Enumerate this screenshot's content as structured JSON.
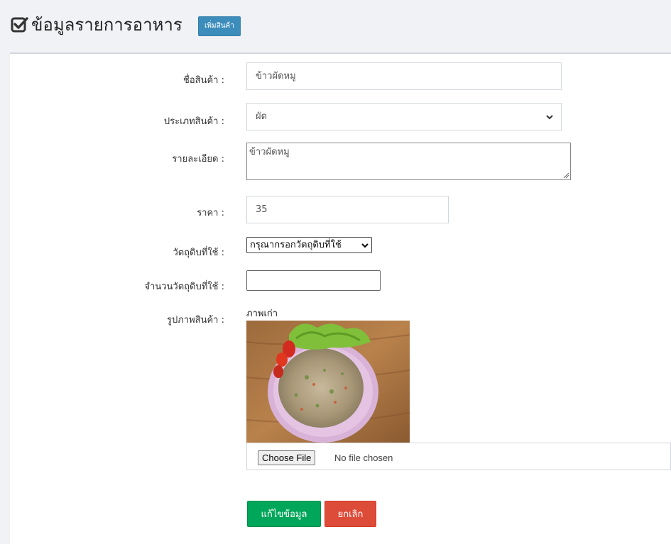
{
  "header": {
    "title": "ข้อมูลรายการอาหาร",
    "add_button": "เพิ่มสินค้า",
    "icon": "check-square-icon"
  },
  "form": {
    "name_label": "ชื่อสินค้า :",
    "name_value": "ข้าวผัดหมู",
    "type_label": "ประเภทสินค้า :",
    "type_value": "ผัด",
    "detail_label": "รายละเอียด :",
    "detail_value": "ข้าวผัดหมู",
    "price_label": "ราคา :",
    "price_value": "35",
    "ingredient_label": "วัตถุดิบที่ใช้ :",
    "ingredient_value": "กรุณากรอกวัตถุดิบที่ใช้",
    "ingredient_qty_label": "จำนวนวัตถุดิบที่ใช้ :",
    "ingredient_qty_value": "",
    "image_label": "รูปภาพสินค้า :",
    "old_image_caption": "ภาพเก่า",
    "choose_file": "Choose File",
    "file_status": "No file chosen"
  },
  "actions": {
    "save": "แก้ไขข้อมูล",
    "cancel": "ยกเลิก"
  },
  "colors": {
    "primary": "#3c8dbc",
    "success": "#00a65a",
    "danger": "#dd4b39"
  }
}
